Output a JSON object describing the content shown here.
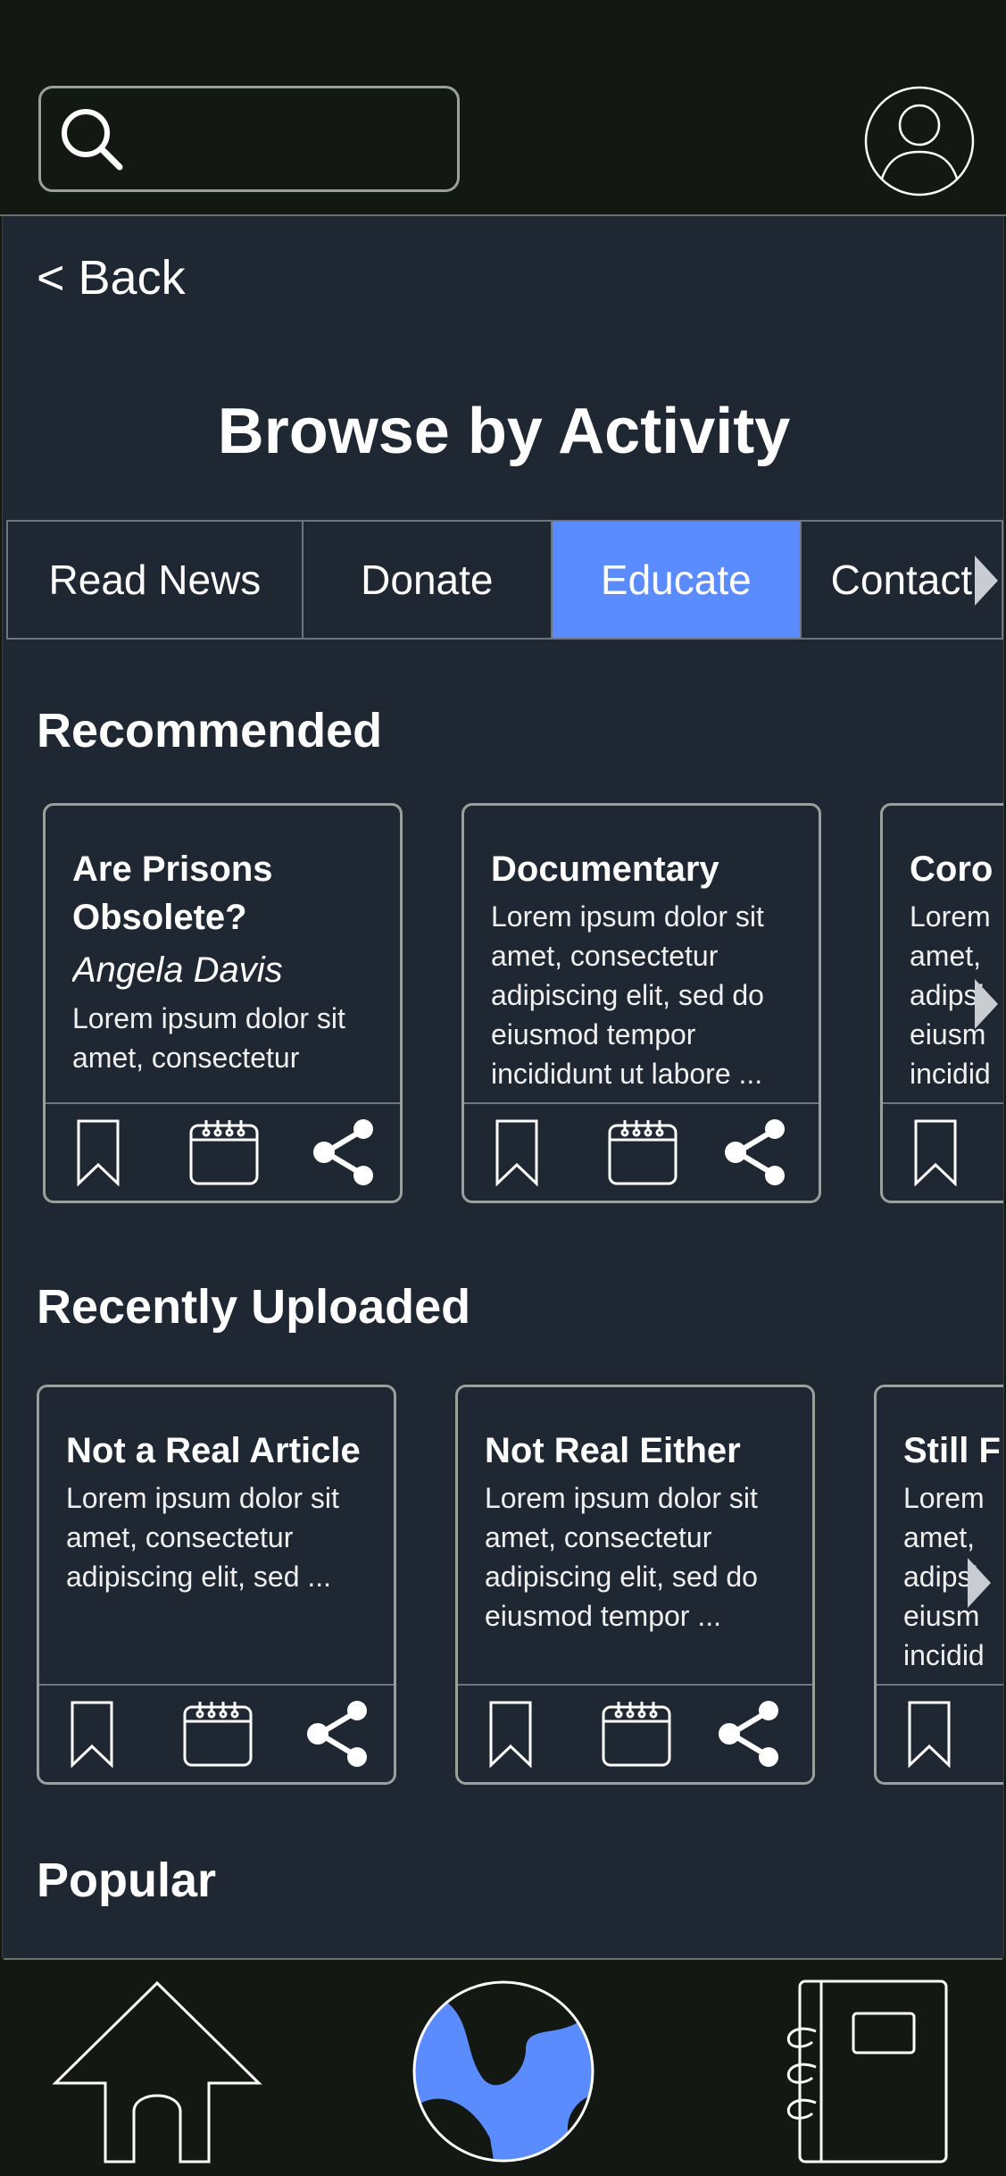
{
  "header": {
    "search_icon": "search-icon",
    "profile_icon": "user-avatar-icon"
  },
  "main": {
    "back_label": "< Back",
    "page_title": "Browse by Activity",
    "tabs": [
      {
        "label": "Read News",
        "active": false
      },
      {
        "label": "Donate",
        "active": false
      },
      {
        "label": "Educate",
        "active": true
      },
      {
        "label": "Contact",
        "active": false
      }
    ],
    "sections": {
      "recommended": {
        "title": "Recommended",
        "cards": [
          {
            "title": "Are Prisons Obsolete?",
            "author": "Angela Davis",
            "text": "Lorem ipsum dolor sit amet, consectetur"
          },
          {
            "title": "Documentary",
            "text": "Lorem ipsum dolor sit amet, consectetur adipiscing elit, sed do eiusmod tempor incididunt ut labore ..."
          },
          {
            "title": "Coro",
            "text": "Lorem amet, adipsi eiusm incidid"
          }
        ]
      },
      "recent": {
        "title": "Recently Uploaded",
        "cards": [
          {
            "title": "Not a Real Article",
            "text": "Lorem ipsum dolor sit amet, consectetur adipiscing elit, sed ..."
          },
          {
            "title": "Not Real Either",
            "text": "Lorem ipsum dolor sit amet, consectetur adipiscing elit, sed do eiusmod tempor ..."
          },
          {
            "title": "Still F",
            "text": "Lorem amet, adipsi eiusm incidid"
          }
        ]
      },
      "popular": {
        "title": "Popular"
      }
    }
  },
  "bottom_nav": {
    "items": [
      "home-icon",
      "globe-icon",
      "notebook-icon"
    ]
  },
  "colors": {
    "accent": "#5b8cff",
    "background": "#1f2732",
    "bar": "#131812"
  }
}
